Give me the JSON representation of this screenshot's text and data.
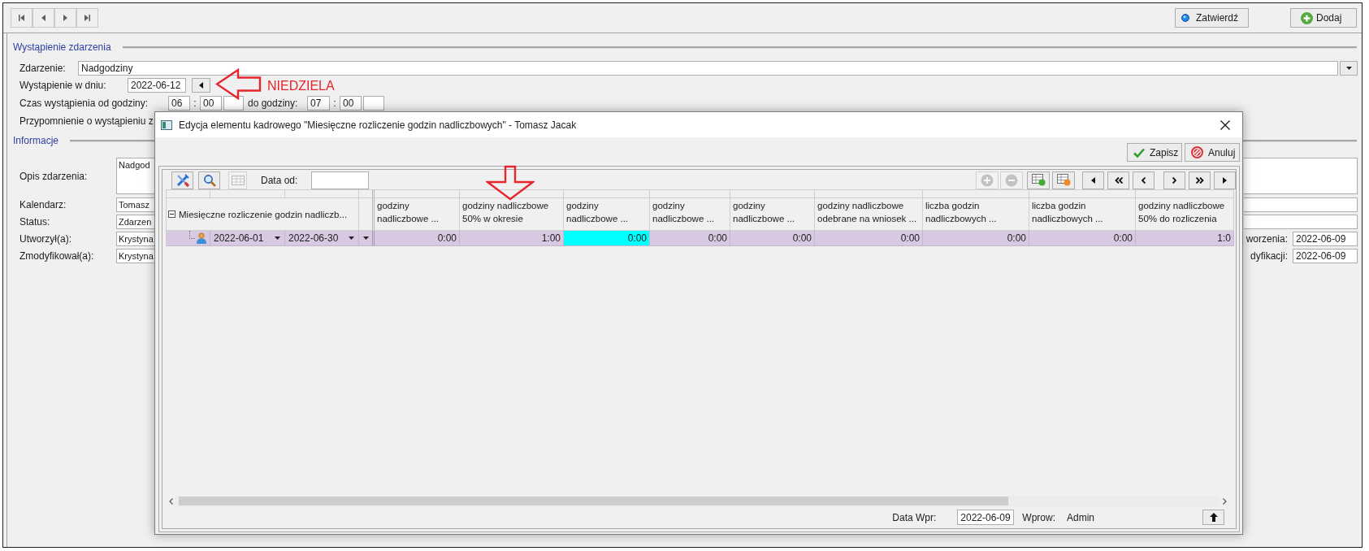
{
  "toolbar": {
    "actions": [
      {
        "kind": "confirm",
        "label": "Zatwierdź"
      },
      {
        "kind": "add",
        "label": "Dodaj"
      }
    ]
  },
  "event_section": {
    "title": "Wystąpienie zdarzenia",
    "event": {
      "label": "Zdarzenie:",
      "value": "Nadgodziny"
    },
    "date": {
      "label": "Wystąpienie w dniu:",
      "value": "2022-06-12"
    },
    "time": {
      "label": "Czas wystąpienia od godziny:",
      "from_hour": "06",
      "from_separator": ":",
      "from_minute": "00",
      "to_label": "do godziny:",
      "to_hour": "07",
      "to_separator": ":",
      "to_minute": "00"
    },
    "reminder": {
      "label": "Przypomnienie o wystąpieniu z"
    }
  },
  "info_section": {
    "title": "Informacje",
    "fields": [
      {
        "kind": "multiline",
        "label": "Opis zdarzenia:",
        "value": "Nadgod"
      },
      {
        "kind": "full",
        "label": "Kalendarz:",
        "value": "Tomasz"
      },
      {
        "kind": "full",
        "label": "Status:",
        "value": "Zdarzen"
      },
      {
        "kind": "split",
        "label": "Utworzył(a):",
        "value": "Krystyna",
        "side_label": "worzenia:",
        "side_value": "2022-06-09"
      },
      {
        "kind": "split",
        "label": "Zmodyfikował(a):",
        "value": "Krystyna",
        "side_label": "dyfikacji:",
        "side_value": "2022-06-09"
      }
    ]
  },
  "annotations": {
    "note": "NIEDZIELA"
  },
  "dialog": {
    "title": "Edycja elementu kadrowego \"Miesięczne rozliczenie godzin nadliczbowych\" - Tomasz Jacak",
    "buttons": [
      {
        "kind": "save",
        "label": "Zapisz"
      },
      {
        "kind": "cancel",
        "label": "Anuluj"
      }
    ],
    "grid_toolbar": {
      "left_tools": [
        {
          "kind": "tools",
          "disabled": false
        },
        {
          "kind": "search",
          "disabled": false
        },
        {
          "kind": "table",
          "disabled": true
        }
      ],
      "date_from": {
        "label": "Data od:"
      },
      "right_tools": [
        {
          "kind": "add",
          "disabled": true
        },
        {
          "kind": "remove",
          "disabled": true
        },
        {
          "kind": "table_add",
          "disabled": false
        },
        {
          "kind": "table_remove",
          "disabled": false
        }
      ]
    },
    "table": {
      "tree_column": {
        "label": "Miesięczne rozliczenie godzin nadliczb...",
        "expanded": true
      },
      "columns": [
        "godziny nadliczbowe ...",
        "godziny nadliczbowe 50% w okresie",
        "godziny nadliczbowe ...",
        "godziny nadliczbowe ...",
        "godziny nadliczbowe ...",
        "godziny nadliczbowe odebrane na wniosek ...",
        "liczba godzin nadliczbowych ...",
        "liczba godzin nadliczbowych ...",
        "godziny nadliczbowe 50% do rozliczenia"
      ],
      "rows": [
        {
          "selected": true,
          "date_from": "2022-06-01",
          "date_to": "2022-06-30",
          "cells": [
            {
              "value": "0:00",
              "focused": false
            },
            {
              "value": "1:00",
              "focused": false
            },
            {
              "value": "0:00",
              "focused": true
            },
            {
              "value": "0:00",
              "focused": false
            },
            {
              "value": "0:00",
              "focused": false
            },
            {
              "value": "0:00",
              "focused": false
            },
            {
              "value": "0:00",
              "focused": false
            },
            {
              "value": "0:00",
              "focused": false
            },
            {
              "value": "1:0",
              "focused": false
            }
          ]
        }
      ]
    },
    "footer": {
      "entry_date_label": "Data Wpr:",
      "entry_date": "2022-06-09",
      "entered_by_label": "Wprow:",
      "entered_by": "Admin"
    }
  }
}
